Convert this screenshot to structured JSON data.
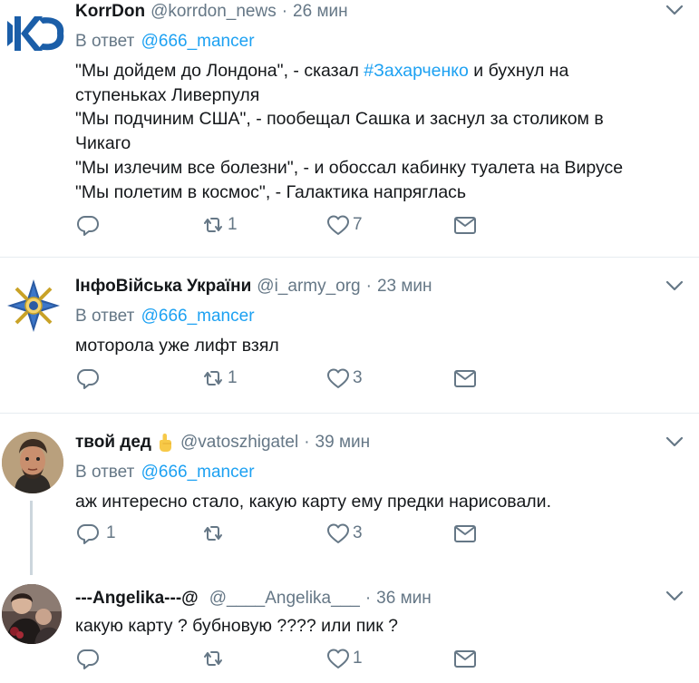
{
  "tweets": [
    {
      "name": "KorrDon",
      "handle": "@korrdon_news",
      "time": "26 мин",
      "reply_prefix": "В ответ",
      "reply_to": "@666_mancer",
      "lines": [
        {
          "pre": "\"Мы дойдем до Лондона\", - сказал ",
          "tag": "#Захарченко",
          "post": " и бухнул на"
        },
        {
          "pre": "ступеньках Ливерпуля",
          "tag": "",
          "post": ""
        },
        {
          "pre": "\"Мы подчиним США\", - пообещал Сашка и заснул за столиком в",
          "tag": "",
          "post": ""
        },
        {
          "pre": "Чикаго",
          "tag": "",
          "post": ""
        },
        {
          "pre": "\"Мы излечим все болезни\", - и обоссал кабинку туалета на Вирусе",
          "tag": "",
          "post": ""
        },
        {
          "pre": "\"Мы полетим в космос\", - Галактика напряглась",
          "tag": "",
          "post": ""
        }
      ],
      "replies": "",
      "retweets": "1",
      "likes": "7"
    },
    {
      "name": "ІнфоВійська України",
      "handle": "@i_army_org",
      "time": "23 мин",
      "reply_prefix": "В ответ",
      "reply_to": "@666_mancer",
      "lines": [
        {
          "pre": "моторола уже лифт взял",
          "tag": "",
          "post": ""
        }
      ],
      "replies": "",
      "retweets": "1",
      "likes": "3"
    },
    {
      "name": "твой дед",
      "handle": "@vatoszhigatel",
      "time": "39 мин",
      "reply_prefix": "В ответ",
      "reply_to": "@666_mancer",
      "lines": [
        {
          "pre": "аж интересно стало, какую карту ему предки нарисовали.",
          "tag": "",
          "post": ""
        }
      ],
      "replies": "1",
      "retweets": "",
      "likes": "3"
    },
    {
      "name": "---Angelika---@",
      "handle": "@____Angelika___",
      "time": "36 мин",
      "reply_prefix": "",
      "reply_to": "",
      "lines": [
        {
          "pre": "какую карту ? бубновую ???? или пик ?",
          "tag": "",
          "post": ""
        }
      ],
      "replies": "",
      "retweets": "",
      "likes": "1"
    }
  ],
  "colors": {
    "accent": "#1da1f2",
    "muted": "#657786",
    "divider": "#e6ecf0"
  },
  "icons": [
    "reply-icon",
    "retweet-icon",
    "like-icon",
    "direct-message-icon",
    "caret-down-icon",
    "pointing-up-emoji"
  ]
}
